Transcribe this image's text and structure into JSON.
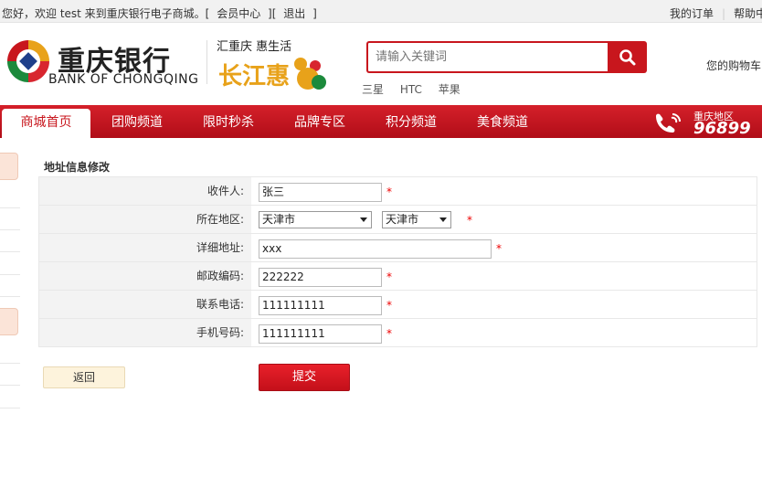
{
  "topbar": {
    "greeting": "您好，欢迎 test 来到重庆银行电子商城。[",
    "member_center": "会员中心",
    "bracket_mid": "][",
    "logout": "退出",
    "bracket_end": "]",
    "my_orders": "我的订单",
    "help_center": "帮助中心"
  },
  "header": {
    "bank_name_cn": "重庆银行",
    "bank_name_en": "BANK OF CHONGQING",
    "slogan": "汇重庆 惠生活",
    "mall_logo_text": "长江惠",
    "search_placeholder": "请输入关键词",
    "hot_words": [
      "三星",
      "HTC",
      "苹果"
    ],
    "cart_text": "您的购物车中"
  },
  "nav": {
    "items": [
      "商城首页",
      "团购频道",
      "限时秒杀",
      "品牌专区",
      "积分频道",
      "美食频道"
    ],
    "active_index": 0,
    "hotline_region": "重庆地区",
    "hotline_number": "96899"
  },
  "form": {
    "title": "地址信息修改",
    "rows": [
      {
        "label": "收件人:",
        "value": "张三"
      },
      {
        "label": "所在地区:",
        "province": "天津市",
        "city": "天津市"
      },
      {
        "label": "详细地址:",
        "value": "xxx"
      },
      {
        "label": "邮政编码:",
        "value": "222222"
      },
      {
        "label": "联系电话:",
        "value": "111111111"
      },
      {
        "label": "手机号码:",
        "value": "111111111"
      }
    ],
    "required_mark": "*",
    "back_label": "返回",
    "submit_label": "提交"
  },
  "colors": {
    "brand_red": "#c8161d",
    "nav_red": "#d5202a",
    "label_bg": "#f3f3f3"
  }
}
